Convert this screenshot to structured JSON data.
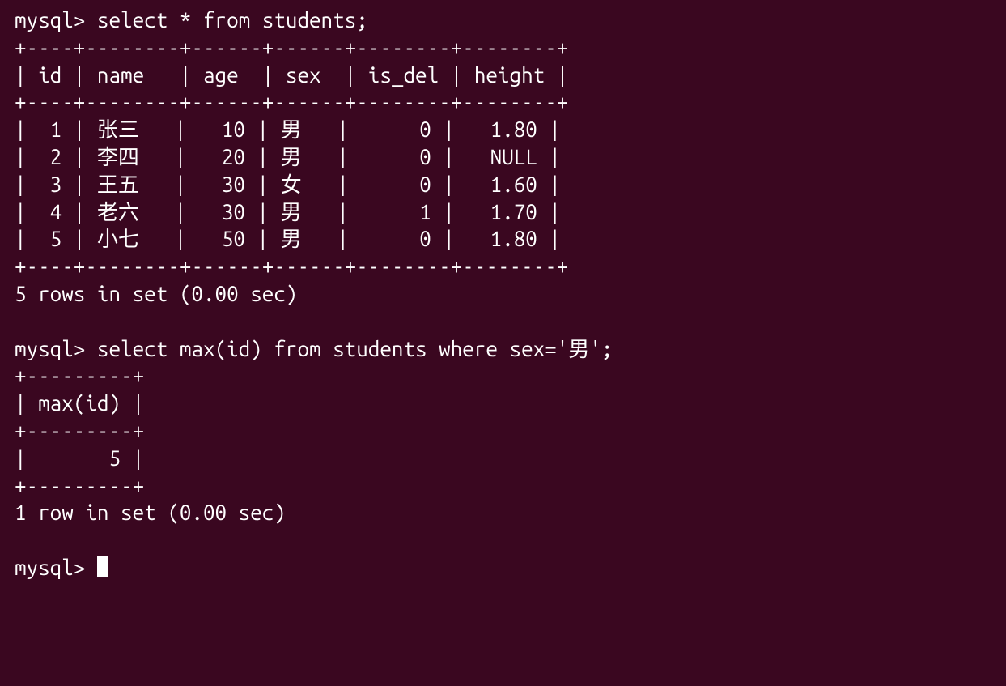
{
  "prompt": "mysql> ",
  "query1": {
    "sql": "select * from students;",
    "border_top": "+----+--------+------+------+--------+--------+",
    "header_row": "| id | name   | age  | sex  | is_del | height |",
    "border_mid": "+----+--------+------+------+--------+--------+",
    "rows": [
      "|  1 | 张三   |   10 | 男   |      0 |   1.80 |",
      "|  2 | 李四   |   20 | 男   |      0 |   NULL |",
      "|  3 | 王五   |   30 | 女   |      0 |   1.60 |",
      "|  4 | 老六   |   30 | 男   |      1 |   1.70 |",
      "|  5 | 小七   |   50 | 男   |      0 |   1.80 |"
    ],
    "border_bot": "+----+--------+------+------+--------+--------+",
    "status": "5 rows in set (0.00 sec)"
  },
  "query2": {
    "sql": "select max(id) from students where sex='男';",
    "border_top": "+---------+",
    "header_row": "| max(id) |",
    "border_mid": "+---------+",
    "rows": [
      "|       5 |"
    ],
    "border_bot": "+---------+",
    "status": "1 row in set (0.00 sec)"
  },
  "table_data": {
    "columns": [
      "id",
      "name",
      "age",
      "sex",
      "is_del",
      "height"
    ],
    "rows": [
      {
        "id": 1,
        "name": "张三",
        "age": 10,
        "sex": "男",
        "is_del": 0,
        "height": 1.8
      },
      {
        "id": 2,
        "name": "李四",
        "age": 20,
        "sex": "男",
        "is_del": 0,
        "height": null
      },
      {
        "id": 3,
        "name": "王五",
        "age": 30,
        "sex": "女",
        "is_del": 0,
        "height": 1.6
      },
      {
        "id": 4,
        "name": "老六",
        "age": 30,
        "sex": "男",
        "is_del": 1,
        "height": 1.7
      },
      {
        "id": 5,
        "name": "小七",
        "age": 50,
        "sex": "男",
        "is_del": 0,
        "height": 1.8
      }
    ]
  },
  "aggregate_result": {
    "column": "max(id)",
    "value": 5
  }
}
